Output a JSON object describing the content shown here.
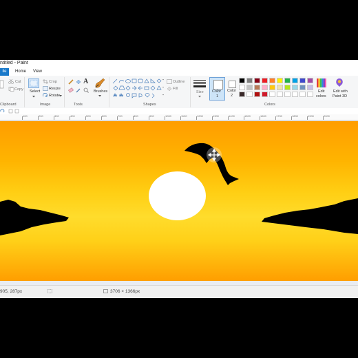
{
  "window": {
    "title": "ntitled - Paint"
  },
  "menu": {
    "file": "ile",
    "home": "Home",
    "view": "View"
  },
  "clipboard": {
    "cut": "Cut",
    "copy": "Copy",
    "label": "Clipboard"
  },
  "image": {
    "select": "Select",
    "crop": "Crop",
    "resize": "Resize",
    "rotate": "Rotate",
    "label": "Image"
  },
  "tools": {
    "label": "Tools",
    "text_icon": "A"
  },
  "brushes": {
    "label": "Brushes"
  },
  "shapes": {
    "outline": "Outline",
    "fill": "Fill",
    "label": "Shapes"
  },
  "size": {
    "label": "Size"
  },
  "colors": {
    "color1": "Color",
    "color1_num": "1",
    "color2": "Color",
    "color2_num": "2",
    "label": "Colors",
    "edit": "Edit",
    "edit2": "colors",
    "edit3d": "Edit with",
    "edit3d2": "Paint 3D",
    "palette_row1": [
      "#000000",
      "#7f7f7f",
      "#880015",
      "#ed1c24",
      "#ff7f27",
      "#fff200",
      "#22b14c",
      "#00a2e8",
      "#3f48cc",
      "#a349a4"
    ],
    "palette_row2": [
      "#ffffff",
      "#c3c3c3",
      "#b97a57",
      "#ffaec9",
      "#ffc90e",
      "#efe4b0",
      "#b5e61d",
      "#99d9ea",
      "#7092be",
      "#c8bfe7"
    ],
    "palette_row3": [
      "#3a2a2a",
      "#ffffff",
      "#b01010",
      "#d01a2a",
      "#ffffff",
      "#ffffff",
      "#ffffff",
      "#ffffff",
      "#ffffff",
      "#ffffff"
    ]
  },
  "status": {
    "position": "905, 287px",
    "size": "3706 × 1366px"
  },
  "ruler": [
    "100",
    "200",
    "300",
    "400",
    "500",
    "600",
    "700",
    "800",
    "900",
    "1000",
    "1100",
    "1200",
    "1300",
    "1400",
    "1500",
    "1600",
    "1700",
    "1800",
    "1900",
    "2000"
  ]
}
